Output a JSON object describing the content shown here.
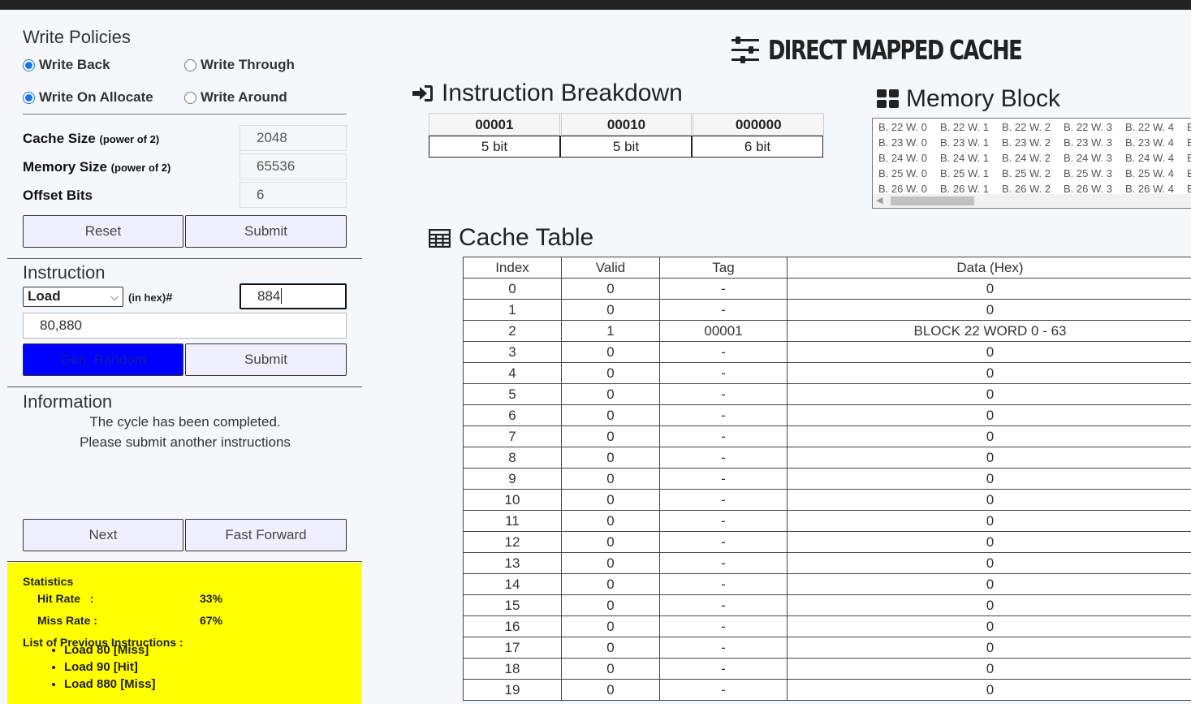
{
  "app": {
    "title": "DIRECT MAPPED CACHE"
  },
  "write_policies": {
    "title": "Write Policies",
    "hit_options": [
      {
        "label": "Write Back",
        "checked": true
      },
      {
        "label": "Write Through",
        "checked": false
      }
    ],
    "miss_options": [
      {
        "label": "Write On Allocate",
        "checked": true
      },
      {
        "label": "Write Around",
        "checked": false
      }
    ]
  },
  "config": {
    "cache_size_label": "Cache Size",
    "cache_size_hint": "(power of 2)",
    "cache_size_value": "2048",
    "memory_size_label": "Memory Size",
    "memory_size_hint": "(power of 2)",
    "memory_size_value": "65536",
    "offset_bits_label": "Offset Bits",
    "offset_bits_value": "6",
    "reset_label": "Reset",
    "submit_label": "Submit"
  },
  "instruction": {
    "title": "Instruction",
    "op_selected": "Load",
    "hex_label": "(in hex)",
    "hash": "#",
    "address_value": "884",
    "sequence_value": "80,880",
    "gen_random_label": "Gen. Random",
    "submit_label": "Submit"
  },
  "information": {
    "title": "Information",
    "line1": "The cycle has been completed.",
    "line2": "Please submit another instructions",
    "next_label": "Next",
    "fast_forward_label": "Fast Forward"
  },
  "statistics": {
    "title": "Statistics",
    "hit_rate_label": "Hit Rate   :",
    "hit_rate_value": "33%",
    "miss_rate_label": "Miss Rate :",
    "miss_rate_value": "67%",
    "history_title": "List of Previous Instructions :",
    "history": [
      "Load 80 [Miss]",
      "Load 90 [Hit]",
      "Load 880 [Miss]"
    ]
  },
  "breakdown": {
    "title": "Instruction Breakdown",
    "fields": [
      {
        "bits": "00001",
        "size": "5 bit"
      },
      {
        "bits": "00010",
        "size": "5 bit"
      },
      {
        "bits": "000000",
        "size": "6 bit"
      }
    ]
  },
  "memory_block": {
    "title": "Memory Block",
    "rows": [
      [
        "B. 22 W. 0",
        "B. 22 W. 1",
        "B. 22 W. 2",
        "B. 22 W. 3",
        "B. 22 W. 4",
        "B"
      ],
      [
        "B. 23 W. 0",
        "B. 23 W. 1",
        "B. 23 W. 2",
        "B. 23 W. 3",
        "B. 23 W. 4",
        "B"
      ],
      [
        "B. 24 W. 0",
        "B. 24 W. 1",
        "B. 24 W. 2",
        "B. 24 W. 3",
        "B. 24 W. 4",
        "B"
      ],
      [
        "B. 25 W. 0",
        "B. 25 W. 1",
        "B. 25 W. 2",
        "B. 25 W. 3",
        "B. 25 W. 4",
        "B"
      ],
      [
        "B. 26 W. 0",
        "B. 26 W. 1",
        "B. 26 W. 2",
        "B. 26 W. 3",
        "B. 26 W. 4",
        "B"
      ]
    ]
  },
  "cache_table": {
    "title": "Cache Table",
    "columns": [
      "Index",
      "Valid",
      "Tag",
      "Data (Hex)"
    ],
    "rows": [
      [
        "0",
        "0",
        "-",
        "0"
      ],
      [
        "1",
        "0",
        "-",
        "0"
      ],
      [
        "2",
        "1",
        "00001",
        "BLOCK 22 WORD 0 - 63"
      ],
      [
        "3",
        "0",
        "-",
        "0"
      ],
      [
        "4",
        "0",
        "-",
        "0"
      ],
      [
        "5",
        "0",
        "-",
        "0"
      ],
      [
        "6",
        "0",
        "-",
        "0"
      ],
      [
        "7",
        "0",
        "-",
        "0"
      ],
      [
        "8",
        "0",
        "-",
        "0"
      ],
      [
        "9",
        "0",
        "-",
        "0"
      ],
      [
        "10",
        "0",
        "-",
        "0"
      ],
      [
        "11",
        "0",
        "-",
        "0"
      ],
      [
        "12",
        "0",
        "-",
        "0"
      ],
      [
        "13",
        "0",
        "-",
        "0"
      ],
      [
        "14",
        "0",
        "-",
        "0"
      ],
      [
        "15",
        "0",
        "-",
        "0"
      ],
      [
        "16",
        "0",
        "-",
        "0"
      ],
      [
        "17",
        "0",
        "-",
        "0"
      ],
      [
        "18",
        "0",
        "-",
        "0"
      ],
      [
        "19",
        "0",
        "-",
        "0"
      ]
    ]
  },
  "icons": {
    "title_icon": "sliders-icon",
    "breakdown_icon": "sign-in-icon",
    "memory_icon": "th-large-icon",
    "table_icon": "table-icon"
  },
  "colors": {
    "gen_random_bg": "#0000ff",
    "statistics_bg": "#ffff00",
    "radio_accent": "#1a73e8"
  }
}
